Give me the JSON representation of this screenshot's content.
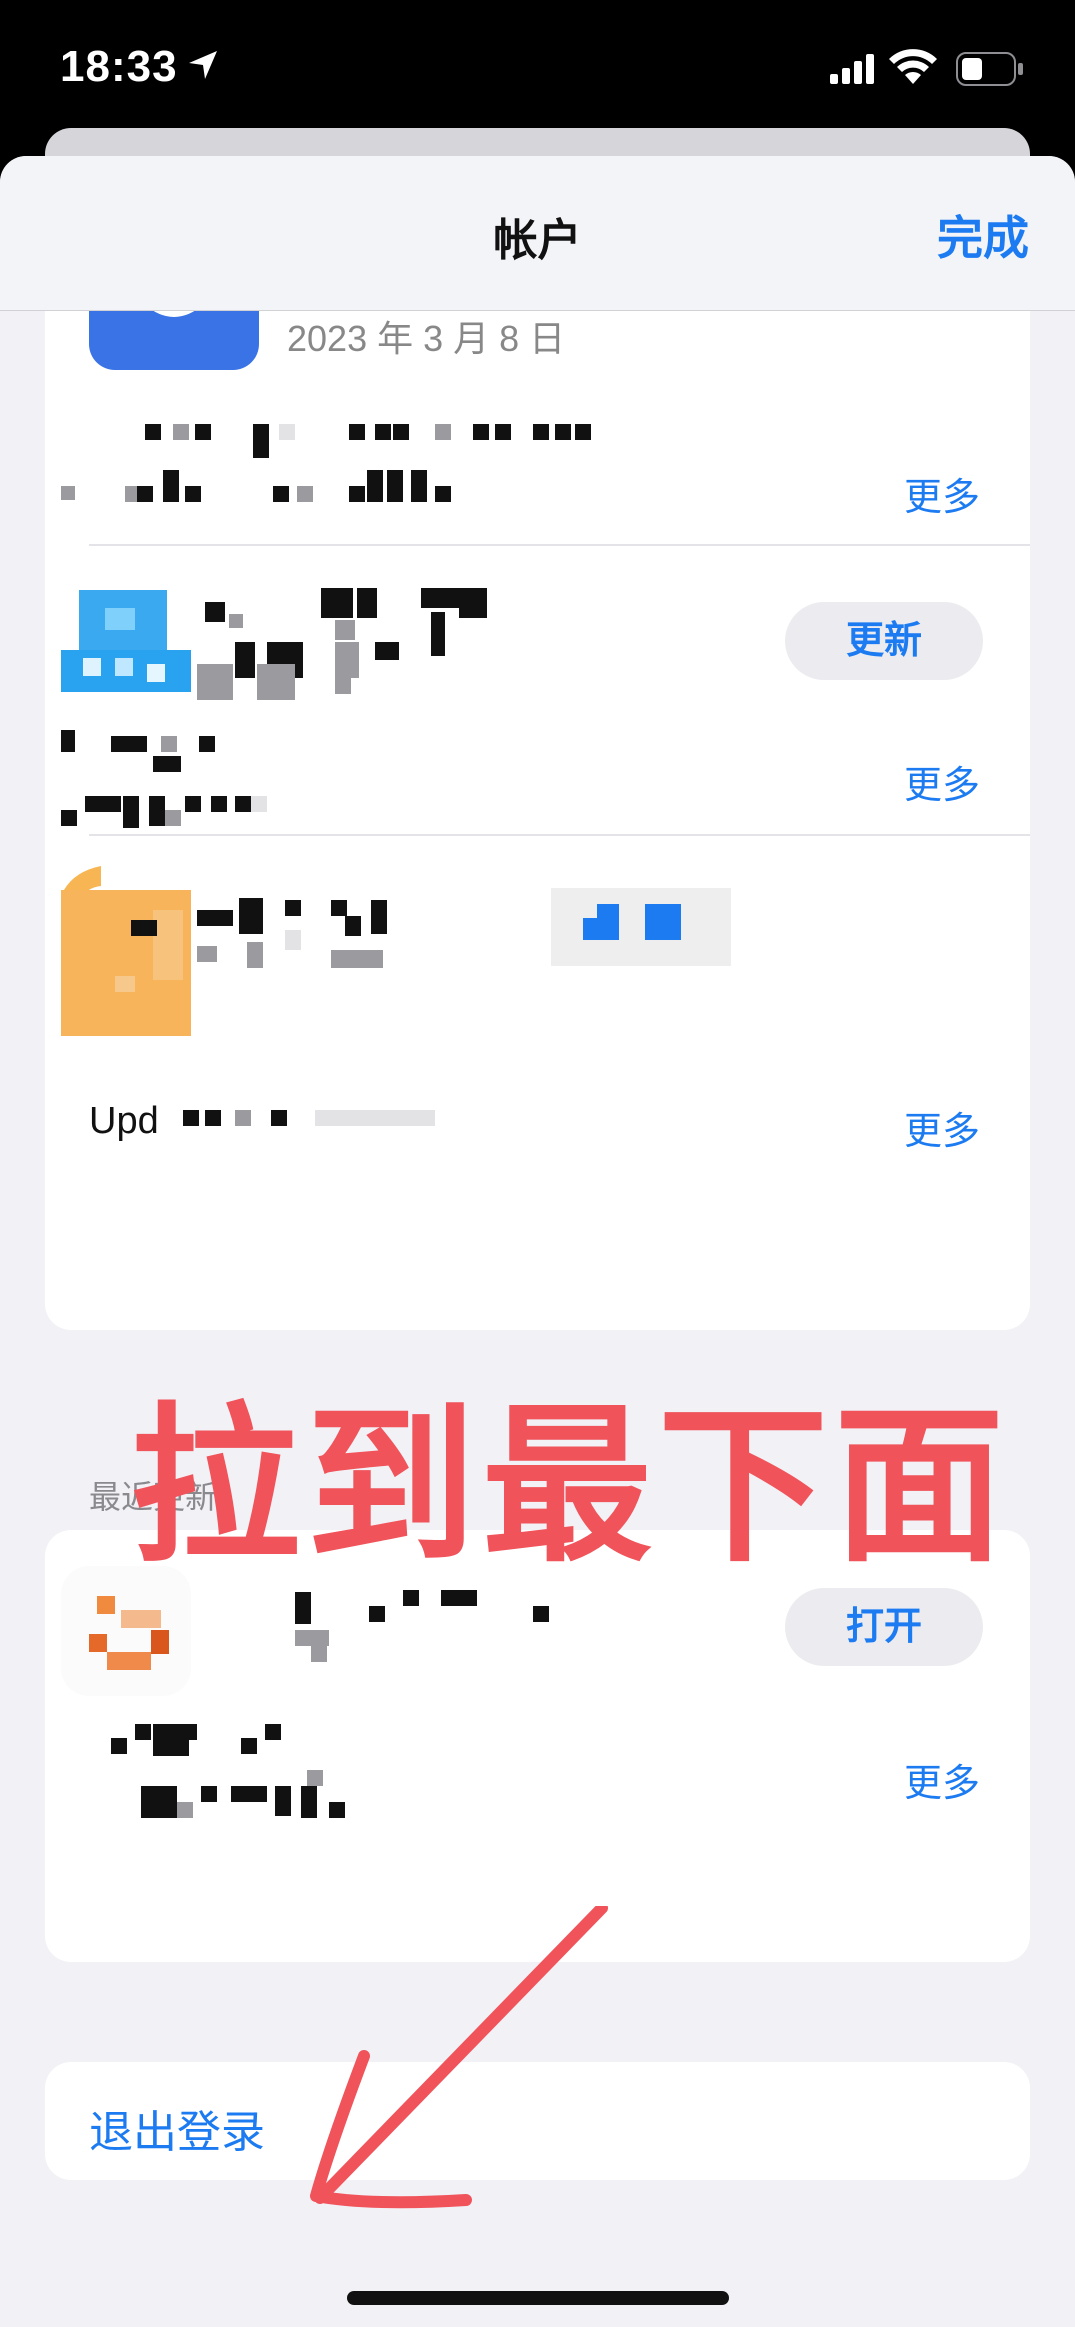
{
  "status_bar": {
    "time": "18:33"
  },
  "nav": {
    "title": "帐户",
    "done_label": "完成"
  },
  "updates": [
    {
      "date": "2023 年 3 月 8 日",
      "more_label": "更多"
    },
    {
      "button_label": "更新",
      "more_label": "更多"
    },
    {
      "notes_prefix": "Upd",
      "more_label": "更多"
    }
  ],
  "recent": {
    "header": "最近更新",
    "items": [
      {
        "button_label": "打开",
        "more_label": "更多"
      }
    ]
  },
  "overlay_text": "拉到最下面",
  "logout_label": "退出登录",
  "colors": {
    "accent": "#1d7bf2",
    "annotation": "#f0535a",
    "sheet_bg": "#f1f1f6"
  }
}
